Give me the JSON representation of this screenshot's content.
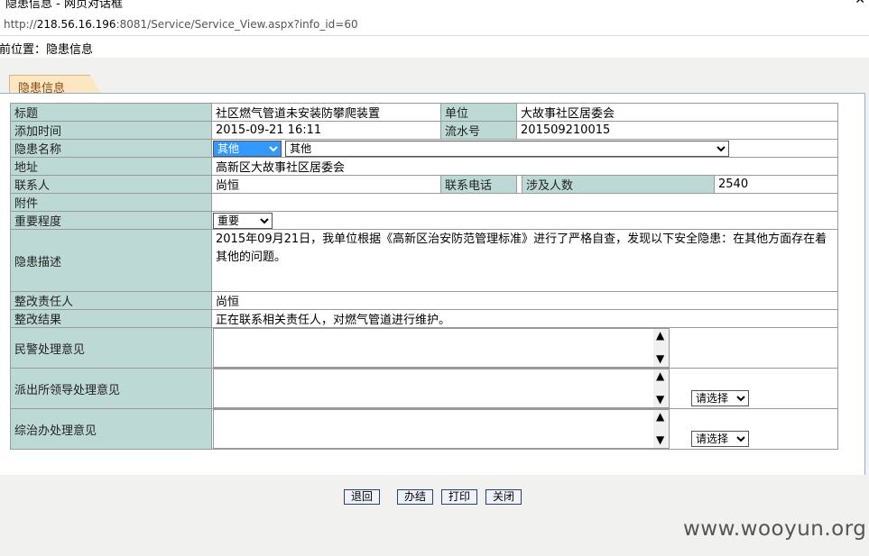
{
  "window": {
    "title": "隐患信息 - 网页对话框",
    "close": "✕"
  },
  "url": {
    "prefix": "http://",
    "host": "218.56.16.196",
    "rest": ":8081/Service/Service_View.aspx?info_id=60"
  },
  "breadcrumb": "前位置：隐患信息",
  "tab": "隐患信息",
  "form": {
    "title_label": "标题",
    "title_value": "社区燃气管道未安装防攀爬装置",
    "unit_label": "单位",
    "unit_value": "大故事社区居委会",
    "time_label": "添加时间",
    "time_value": "2015-09-21 16:11",
    "serial_label": "流水号",
    "serial_value": "201509210015",
    "hazard_name_label": "隐患名称",
    "hazard_type": "其他",
    "hazard_name": "其他",
    "address_label": "地址",
    "address_value": "高新区大故事社区居委会",
    "contact_label": "联系人",
    "contact_value": "尚恒",
    "phone_label": "联系电话",
    "phone_value": "",
    "people_label": "涉及人数",
    "people_value": "2540",
    "attachment_label": "附件",
    "importance_label": "重要程度",
    "importance_value": "重要",
    "desc_label": "隐患描述",
    "desc_value": "2015年09月21日，我单位根据《高新区治安防范管理标准》进行了严格自查，发现以下安全隐患：在其他方面存在着其他的问题。",
    "responsible_label": "整改责任人",
    "responsible_value": "尚恒",
    "result_label": "整改结果",
    "result_value": "正在联系相关责任人，对燃气管道进行维护。",
    "police_label": "民警处理意见",
    "station_label": "派出所领导处理意见",
    "station_select": "请选择",
    "office_label": "综治办处理意见",
    "office_select": "请选择"
  },
  "buttons": {
    "back": "退回",
    "finish": "办结",
    "print": "打印",
    "close": "关闭"
  },
  "watermark": "www.wooyun.org"
}
